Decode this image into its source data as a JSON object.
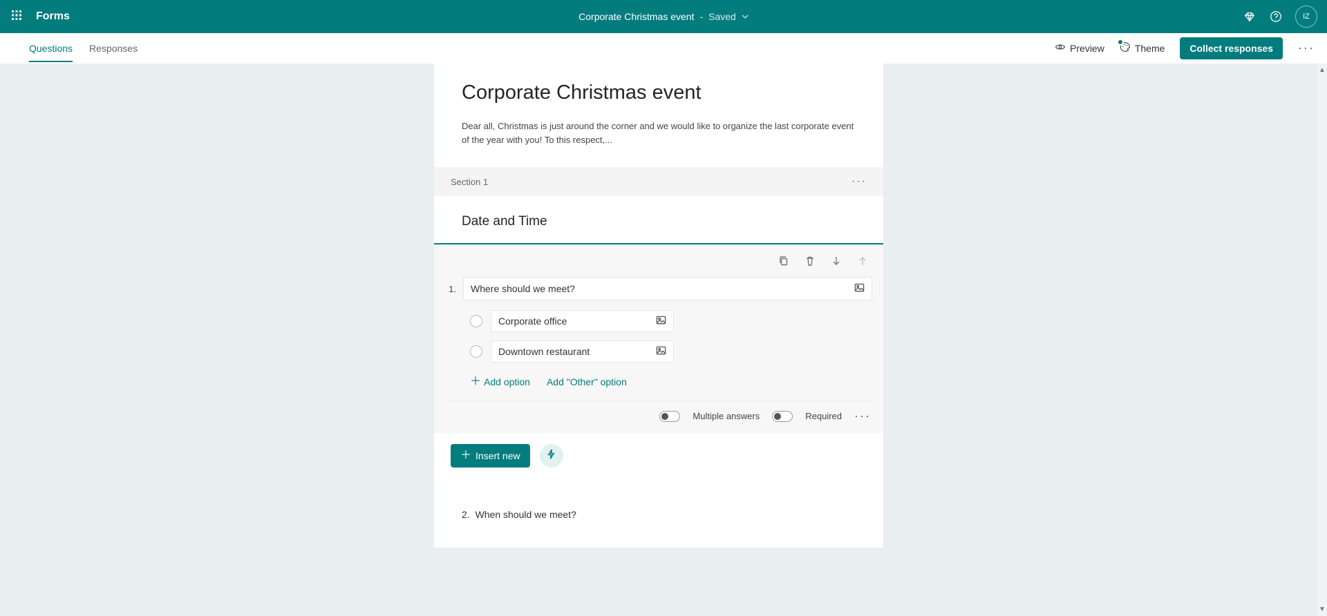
{
  "app": {
    "name": "Forms"
  },
  "doc": {
    "title": "Corporate Christmas event",
    "dash": "-",
    "save_state": "Saved"
  },
  "avatar": "IZ",
  "tabs": {
    "questions": "Questions",
    "responses": "Responses"
  },
  "cmd": {
    "preview": "Preview",
    "theme": "Theme",
    "collect": "Collect responses"
  },
  "form": {
    "title": "Corporate Christmas event",
    "description": "Dear all, Christmas is just around the corner and we would like to organize the last corporate event of the year with you! To this respect,..."
  },
  "section": {
    "label": "Section 1",
    "title": "Date and Time"
  },
  "q1": {
    "number": "1.",
    "text": "Where should we meet?",
    "options": [
      "Corporate office",
      "Downtown restaurant"
    ],
    "add_option": "Add option",
    "add_other": "Add \"Other\" option",
    "multiple": "Multiple answers",
    "required": "Required"
  },
  "insert": {
    "label": "Insert new"
  },
  "q2": {
    "number": "2.",
    "text": "When should we meet?"
  }
}
